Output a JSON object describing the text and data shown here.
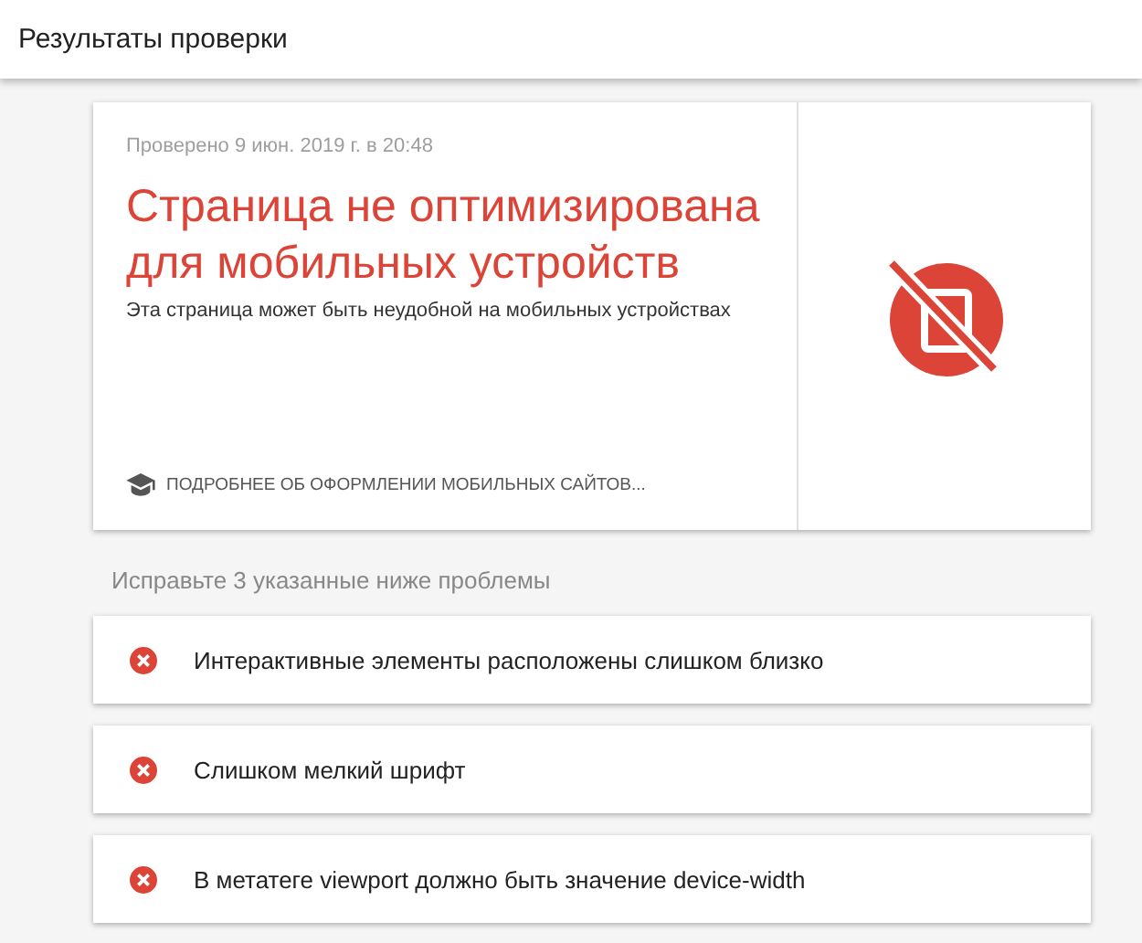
{
  "header": {
    "title": "Результаты проверки"
  },
  "result": {
    "checked_at": "Проверено 9 июн. 2019 г. в 20:48",
    "headline": "Страница не оптимизирована для мобильных устройств",
    "description": "Эта страница может быть неудобной на мобильных устройствах",
    "learn_more": "ПОДРОБНЕЕ ОБ ОФОРМЛЕНИИ МОБИЛЬНЫХ САЙТОВ..."
  },
  "issues_heading": "Исправьте 3 указанные ниже проблемы",
  "issues": [
    {
      "text": "Интерактивные элементы расположены слишком близко"
    },
    {
      "text": "Слишком мелкий шрифт"
    },
    {
      "text": "В метатеге viewport должно быть значение device-width"
    }
  ]
}
